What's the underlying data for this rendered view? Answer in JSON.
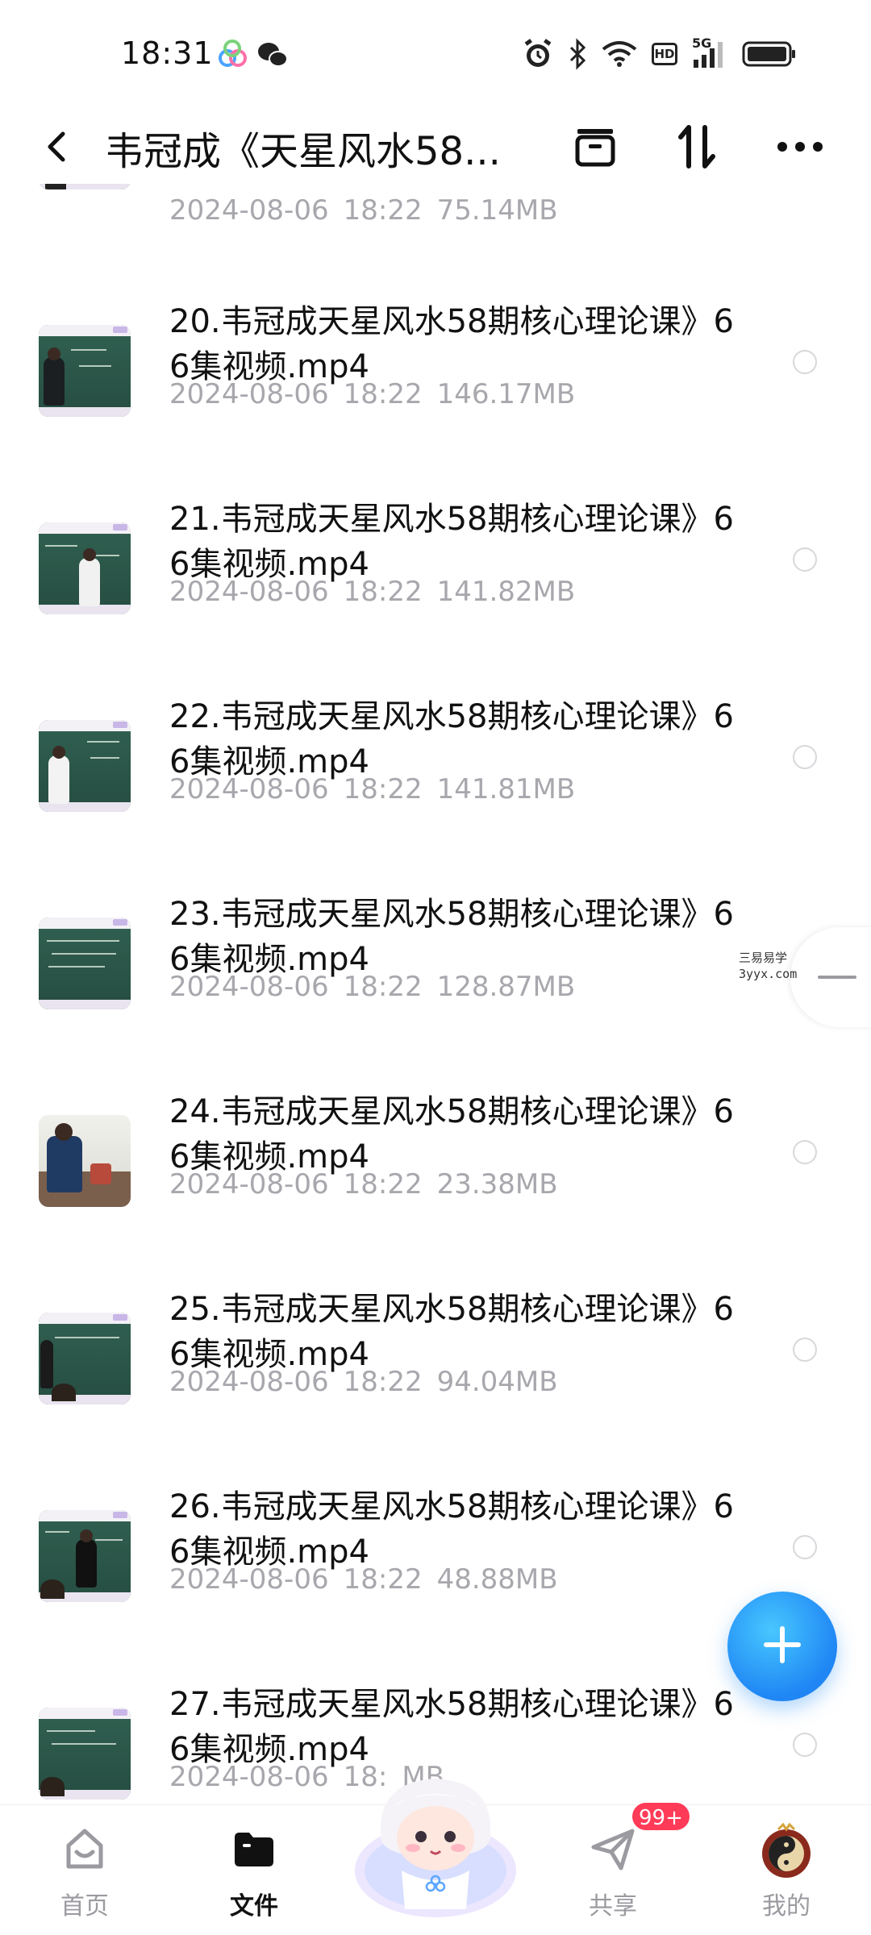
{
  "status_bar": {
    "time": "18:31",
    "icons": [
      "assistant-app-icon",
      "wechat-icon",
      "alarm-icon",
      "bluetooth-icon",
      "wifi-icon",
      "hd-icon",
      "5g-signal-icon",
      "battery-icon"
    ],
    "hd_label": "HD",
    "network_label": "5G"
  },
  "header": {
    "title": "韦冠成《天星风水58...",
    "actions": [
      "archive-icon",
      "sort-icon",
      "more-icon"
    ]
  },
  "files": [
    {
      "name": "",
      "date": "2024-08-06",
      "time": "18:22",
      "size": "75.14MB"
    },
    {
      "name": "20.韦冠成天星风水58期核心理论课》66集视频.mp4",
      "date": "2024-08-06",
      "time": "18:22",
      "size": "146.17MB"
    },
    {
      "name": "21.韦冠成天星风水58期核心理论课》66集视频.mp4",
      "date": "2024-08-06",
      "time": "18:22",
      "size": "141.82MB"
    },
    {
      "name": "22.韦冠成天星风水58期核心理论课》66集视频.mp4",
      "date": "2024-08-06",
      "time": "18:22",
      "size": "141.81MB"
    },
    {
      "name": "23.韦冠成天星风水58期核心理论课》66集视频.mp4",
      "date": "2024-08-06",
      "time": "18:22",
      "size": "128.87MB"
    },
    {
      "name": "24.韦冠成天星风水58期核心理论课》66集视频.mp4",
      "date": "2024-08-06",
      "time": "18:22",
      "size": "23.38MB"
    },
    {
      "name": "25.韦冠成天星风水58期核心理论课》66集视频.mp4",
      "date": "2024-08-06",
      "time": "18:22",
      "size": "94.04MB"
    },
    {
      "name": "26.韦冠成天星风水58期核心理论课》66集视频.mp4",
      "date": "2024-08-06",
      "time": "18:22",
      "size": "48.88MB"
    },
    {
      "name": "27.韦冠成天星风水58期核心理论课》66集视频.mp4",
      "date": "2024-08-06",
      "time": "18:",
      "size": "MB"
    }
  ],
  "watermark": {
    "line1": "三易易学",
    "line2": "3yyx.com"
  },
  "bottom_nav": {
    "items": [
      {
        "label": "首页",
        "icon": "home-icon",
        "active": false
      },
      {
        "label": "文件",
        "icon": "folder-icon",
        "active": true
      },
      {
        "label": "",
        "icon": "mascot-icon",
        "active": false
      },
      {
        "label": "共享",
        "icon": "share-plane-icon",
        "active": false
      },
      {
        "label": "我的",
        "icon": "profile-avatar-icon",
        "active": false
      }
    ],
    "share_badge": "99+"
  },
  "fab_icon": "plus-icon",
  "colors": {
    "accent": "#1f86f4",
    "meta_text": "#a7a7ad",
    "badge": "#ff3b57"
  }
}
